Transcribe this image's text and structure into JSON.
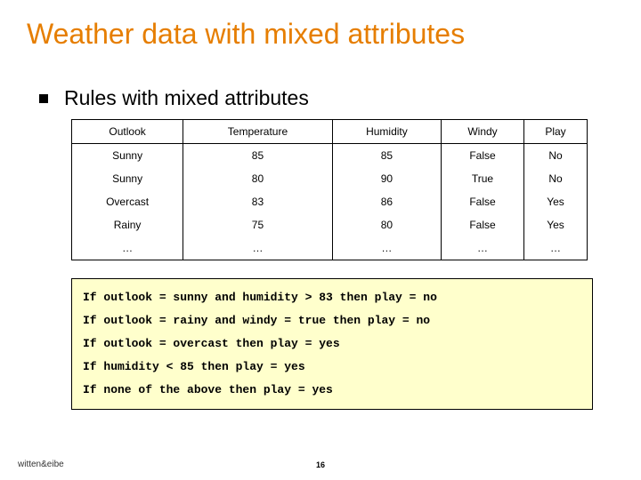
{
  "title": "Weather data with mixed attributes",
  "subtitle": "Rules with mixed attributes",
  "table": {
    "headers": [
      "Outlook",
      "Temperature",
      "Humidity",
      "Windy",
      "Play"
    ],
    "rows": [
      [
        "Sunny",
        "85",
        "85",
        "False",
        "No"
      ],
      [
        "Sunny",
        "80",
        "90",
        "True",
        "No"
      ],
      [
        "Overcast",
        "83",
        "86",
        "False",
        "Yes"
      ],
      [
        "Rainy",
        "75",
        "80",
        "False",
        "Yes"
      ],
      [
        "…",
        "…",
        "…",
        "…",
        "…"
      ]
    ]
  },
  "rules": [
    "If outlook = sunny and humidity > 83 then play = no",
    "If outlook = rainy and windy = true then play = no",
    "If outlook = overcast then play = yes",
    "If humidity < 85 then play = yes",
    "If none of the above then play = yes"
  ],
  "footer": {
    "credit": "witten&eibe",
    "page": "16"
  },
  "chart_data": {
    "type": "table",
    "title": "Weather data with mixed attributes",
    "columns": [
      "Outlook",
      "Temperature",
      "Humidity",
      "Windy",
      "Play"
    ],
    "rows": [
      {
        "Outlook": "Sunny",
        "Temperature": 85,
        "Humidity": 85,
        "Windy": "False",
        "Play": "No"
      },
      {
        "Outlook": "Sunny",
        "Temperature": 80,
        "Humidity": 90,
        "Windy": "True",
        "Play": "No"
      },
      {
        "Outlook": "Overcast",
        "Temperature": 83,
        "Humidity": 86,
        "Windy": "False",
        "Play": "Yes"
      },
      {
        "Outlook": "Rainy",
        "Temperature": 75,
        "Humidity": 80,
        "Windy": "False",
        "Play": "Yes"
      }
    ]
  }
}
